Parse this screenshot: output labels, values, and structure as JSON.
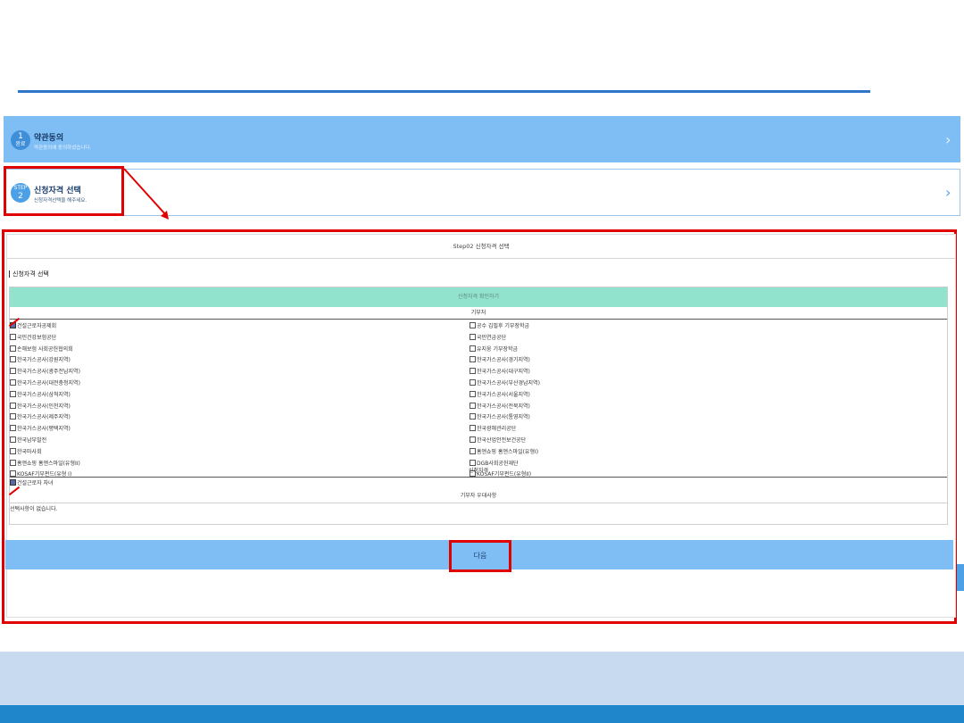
{
  "steps": [
    {
      "badge_top": "1",
      "badge_bottom": "완료",
      "title": "약관동의",
      "subtitle": "약관동의에 동의하셨습니다."
    },
    {
      "badge_top": "STEP",
      "badge_bottom": "2",
      "title": "신청자격 선택",
      "subtitle": "신청자격선택을 해주세요."
    }
  ],
  "panel": {
    "title": "Step02 신청자격 선택",
    "section_label": "신청자격 선택",
    "grid_header": "신청자격 확인하기",
    "grid_subheader": "기부처",
    "left_items": [
      {
        "label": "건설근로자공제회",
        "checked": true
      },
      {
        "label": "국민건강보험공단",
        "checked": false
      },
      {
        "label": "손해보험 사회공헌협의회",
        "checked": false
      },
      {
        "label": "한국가스공사(강원지역)",
        "checked": false
      },
      {
        "label": "한국가스공사(광주전남지역)",
        "checked": false
      },
      {
        "label": "한국가스공사(대전충청지역)",
        "checked": false
      },
      {
        "label": "한국가스공사(삼척지역)",
        "checked": false
      },
      {
        "label": "한국가스공사(인천지역)",
        "checked": false
      },
      {
        "label": "한국가스공사(제주지역)",
        "checked": false
      },
      {
        "label": "한국가스공사(평택지역)",
        "checked": false
      },
      {
        "label": "한국남부발전",
        "checked": false
      },
      {
        "label": "한국마사회",
        "checked": false
      },
      {
        "label": "홈앤쇼핑 홈앤스마일(유형II)",
        "checked": false
      },
      {
        "label": "KOSAF기부펀드(유형 I)",
        "checked": false
      }
    ],
    "right_items": [
      {
        "label": "공수 김필후 기부장학금",
        "checked": false
      },
      {
        "label": "국민연금공단",
        "checked": false
      },
      {
        "label": "유지웅 기부장학금",
        "checked": false
      },
      {
        "label": "한국가스공사(경기지역)",
        "checked": false
      },
      {
        "label": "한국가스공사(대구지역)",
        "checked": false
      },
      {
        "label": "한국가스공사(부산경남지역)",
        "checked": false
      },
      {
        "label": "한국가스공사(서울지역)",
        "checked": false
      },
      {
        "label": "한국가스공사(전북지역)",
        "checked": false
      },
      {
        "label": "한국가스공사(통영지역)",
        "checked": false
      },
      {
        "label": "한국광해관리공단",
        "checked": false
      },
      {
        "label": "한국산업안전보건공단",
        "checked": false
      },
      {
        "label": "홈앤쇼핑 홈앤스마일(유형I)",
        "checked": false
      },
      {
        "label": "DGB사회공헌재단",
        "checked": false
      },
      {
        "label": "KOSAF기부펀드(유형II)",
        "checked": false
      }
    ],
    "qualification_label": "신청자격",
    "qualification_item": {
      "label": "건설근로자 자녀",
      "checked": true
    },
    "priority_label": "기부자 우대사항",
    "priority_empty": "선택사항이 없습니다.",
    "next_label": "다음"
  },
  "colors": {
    "accent": "#7fbef5",
    "highlight": "#e00000",
    "grid_header": "#92e3cd"
  }
}
